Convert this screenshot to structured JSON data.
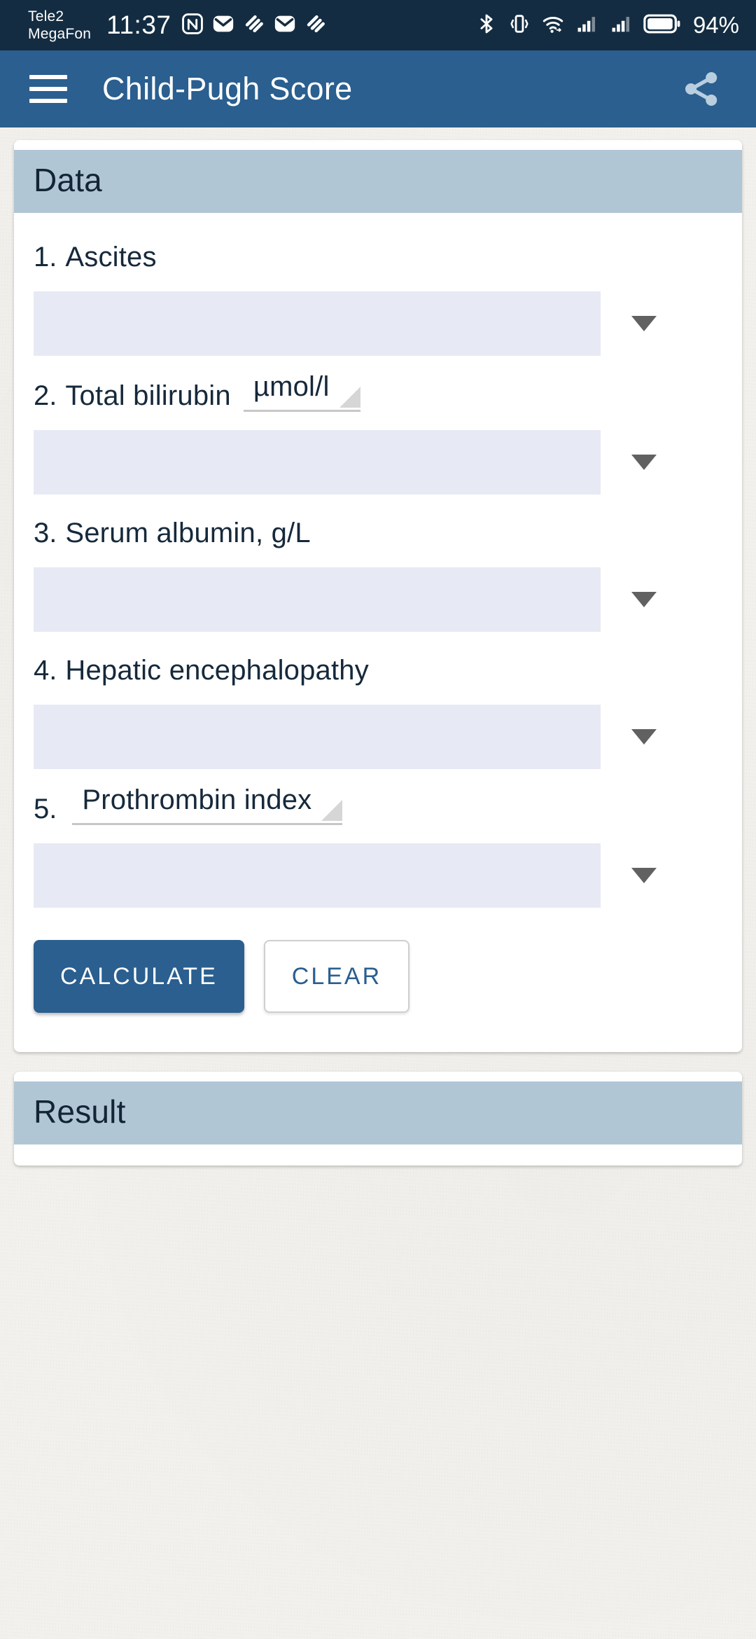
{
  "status_bar": {
    "carrier_line1": "Tele2",
    "carrier_line2": "MegaFon",
    "time": "11:37",
    "battery_percent": "94%",
    "left_icons": [
      "nfc-icon",
      "mail-icon",
      "swoosh-icon",
      "mail-icon",
      "swoosh-icon"
    ],
    "right_icons": [
      "bluetooth-icon",
      "vibrate-icon",
      "wifi-icon",
      "signal-sim1-icon",
      "signal-sim2-icon",
      "battery-icon"
    ],
    "colors": {
      "background": "#132c41",
      "foreground": "#ffffff"
    }
  },
  "app_bar": {
    "menu_icon": "hamburger-menu-icon",
    "title": "Child-Pugh Score",
    "share_icon": "share-icon",
    "colors": {
      "background": "#2a5f8f",
      "foreground": "#ffffff"
    }
  },
  "data_card": {
    "header": "Data",
    "fields": [
      {
        "number": "1.",
        "label": "Ascites",
        "unit": null,
        "value": "",
        "placeholder": "",
        "caret_icon": "chevron-down-icon"
      },
      {
        "number": "2.",
        "label": "Total bilirubin",
        "unit": "µmol/l",
        "value": "",
        "placeholder": "",
        "caret_icon": "chevron-down-icon"
      },
      {
        "number": "3.",
        "label": "Serum albumin, g/L",
        "unit": null,
        "value": "",
        "placeholder": "",
        "caret_icon": "chevron-down-icon"
      },
      {
        "number": "4.",
        "label": "Hepatic encephalopathy",
        "unit": null,
        "value": "",
        "placeholder": "",
        "caret_icon": "chevron-down-icon"
      },
      {
        "number": "5.",
        "label": "",
        "unit": "Prothrombin index",
        "value": "",
        "placeholder": "",
        "caret_icon": "chevron-down-icon"
      }
    ],
    "calculate_label": "CALCULATE",
    "clear_label": "CLEAR"
  },
  "result_card": {
    "header": "Result",
    "body_text": ""
  },
  "colors": {
    "accent": "#2a5f8f",
    "card_header": "#b0c6d5",
    "input_fill": "#e7eaf4",
    "text_dark": "#16293b",
    "page_bg": "#f3f1ed"
  }
}
